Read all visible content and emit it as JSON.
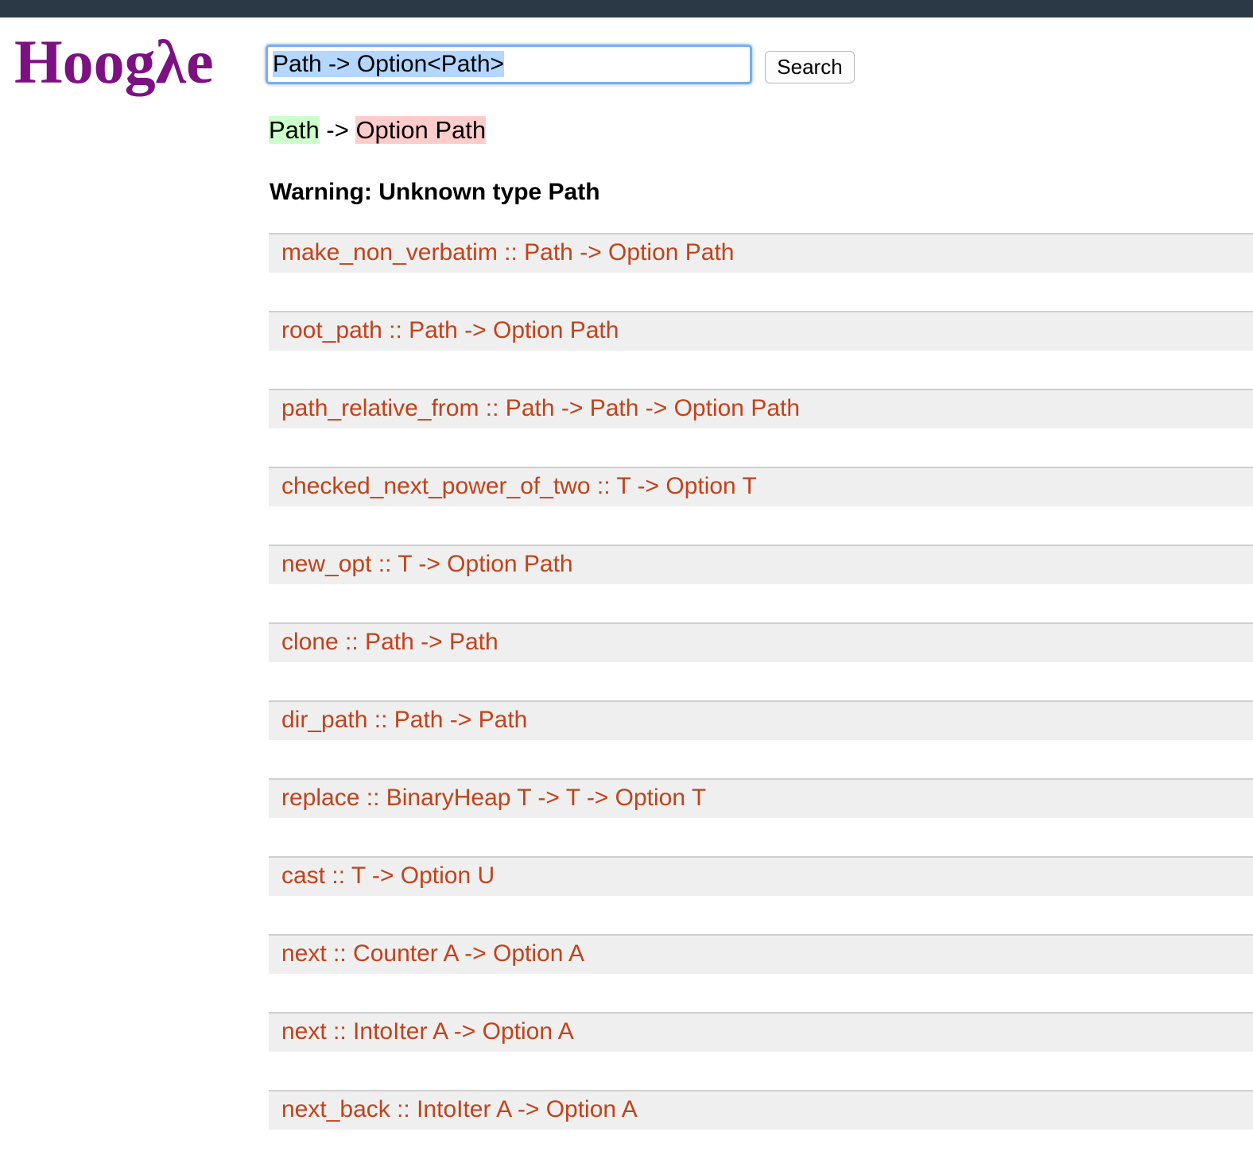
{
  "logo": {
    "text": "Hoogλe"
  },
  "search": {
    "query": "Path -> Option<Path>",
    "button_label": "Search"
  },
  "parsed_query": {
    "arg": "Path",
    "arrow": " -> ",
    "result": "Option Path"
  },
  "warning": "Warning: Unknown type Path",
  "results": [
    {
      "signature": "make_non_verbatim :: Path -> Option Path"
    },
    {
      "signature": "root_path :: Path -> Option Path"
    },
    {
      "signature": "path_relative_from :: Path -> Path -> Option Path"
    },
    {
      "signature": "checked_next_power_of_two :: T -> Option T"
    },
    {
      "signature": "new_opt :: T -> Option Path"
    },
    {
      "signature": "clone :: Path -> Path"
    },
    {
      "signature": "dir_path :: Path -> Path"
    },
    {
      "signature": "replace :: BinaryHeap T -> T -> Option T"
    },
    {
      "signature": "cast :: T -> Option U"
    },
    {
      "signature": "next :: Counter A -> Option A"
    },
    {
      "signature": "next :: IntoIter A -> Option A"
    },
    {
      "signature": "next_back :: IntoIter A -> Option A"
    }
  ],
  "colors": {
    "topbar": "#2b3846",
    "logo": "#7c1181",
    "result_text": "#c2421b",
    "result_bg": "#efefef",
    "known_type_bg": "#ccffcc",
    "unknown_type_bg": "#ffcccc"
  }
}
